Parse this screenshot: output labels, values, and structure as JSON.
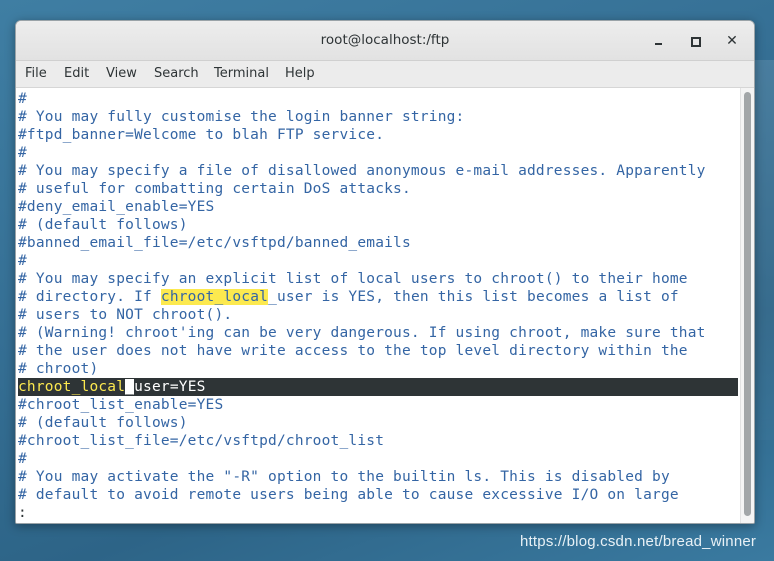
{
  "window": {
    "title": "root@localhost:/ftp",
    "controls": {
      "minimize_icon": "minimize-icon",
      "maximize_icon": "maximize-icon",
      "close_glyph": "✕"
    }
  },
  "menubar": [
    "File",
    "Edit",
    "View",
    "Search",
    "Terminal",
    "Help"
  ],
  "terminal": {
    "lines": [
      "#",
      "# You may fully customise the login banner string:",
      "#ftpd_banner=Welcome to blah FTP service.",
      "#",
      "# You may specify a file of disallowed anonymous e-mail addresses. Apparently",
      "# useful for combatting certain DoS attacks.",
      "#deny_email_enable=YES",
      "# (default follows)",
      "#banned_email_file=/etc/vsftpd/banned_emails",
      "#",
      "# You may specify an explicit list of local users to chroot() to their home"
    ],
    "line_11": {
      "before": "# directory. If ",
      "match": "chroot_local",
      "after": "_user is YES, then this list becomes a list of"
    },
    "lines_b": [
      "# users to NOT chroot().",
      "# (Warning! chroot'ing can be very dangerous. If using chroot, make sure that",
      "# the user does not have write access to the top level directory within the",
      "# chroot)"
    ],
    "cursor_line": {
      "match": "chroot_local",
      "cursor_char": "_",
      "after": "user=YES"
    },
    "lines_c": [
      "#chroot_list_enable=YES",
      "# (default follows)",
      "#chroot_list_file=/etc/vsftpd/chroot_list",
      "#",
      "# You may activate the \"-R\" option to the builtin ls. This is disabled by",
      "# default to avoid remote users being able to cause excessive I/O on large"
    ],
    "prompt": ":"
  },
  "watermark": "https://blog.csdn.net/bread_winner",
  "colors": {
    "text": "#3465a4",
    "highlight": "#fce94f",
    "cursor_line_bg": "#2e3436",
    "desktop": "#356f94"
  }
}
